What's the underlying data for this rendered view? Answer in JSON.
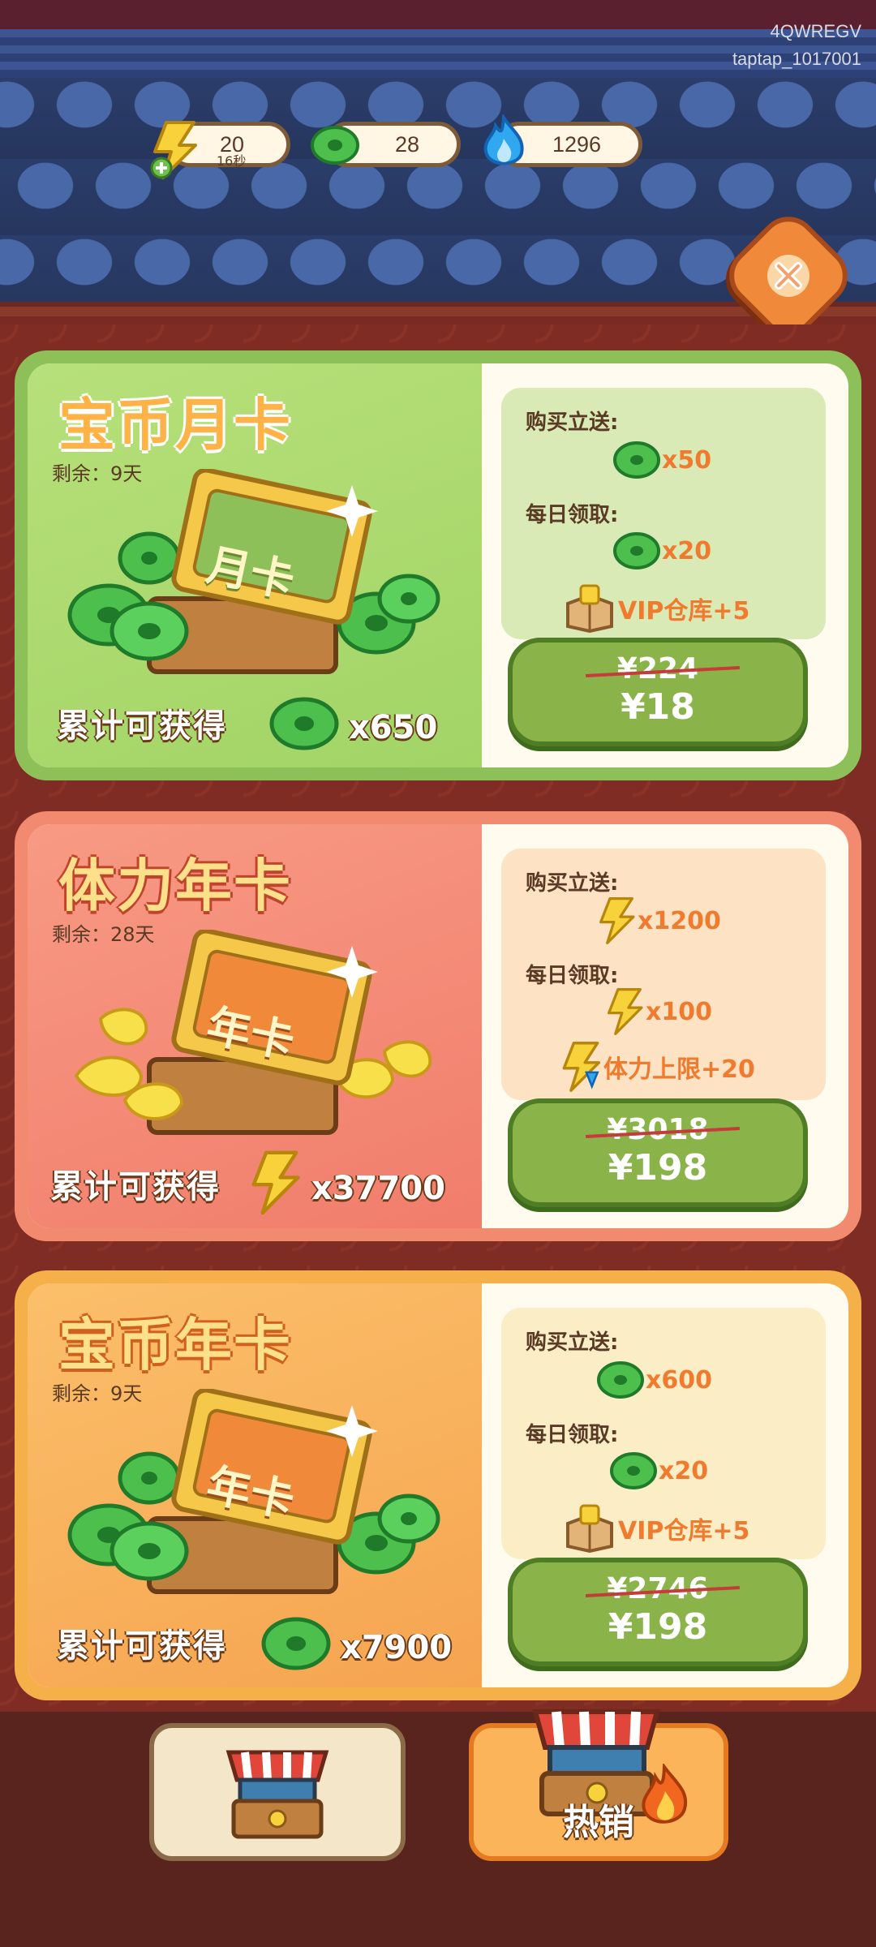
{
  "watermark": {
    "line1": "4QWREGV",
    "line2": "taptap_1017001"
  },
  "resources": {
    "stamina": {
      "value": "20",
      "timer": "16秒",
      "icon": "stamina-bolt-icon"
    },
    "coins": {
      "value": "28",
      "icon": "jade-coin-icon"
    },
    "gems": {
      "value": "1296",
      "icon": "blue-flame-icon"
    }
  },
  "cards": [
    {
      "title": "宝币月卡",
      "remain": "剩余：9天",
      "card_label": "月卡",
      "cumulative_label": "累计可获得",
      "cumulative_value": "x650",
      "buy_gift_label": "购买立送:",
      "buy_gift_value": "x50",
      "daily_label": "每日领取:",
      "daily_value": "x20",
      "bonus": "VIP仓库+5",
      "old_price": "¥224",
      "price": "¥18",
      "theme": {
        "left": "#a9d86e",
        "title": "#ffb347",
        "border": "#8ec05a",
        "box": "#d9eab6",
        "text": "#f07a2e"
      }
    },
    {
      "title": "体力年卡",
      "remain": "剩余：28天",
      "card_label": "年卡",
      "cumulative_label": "累计可获得",
      "cumulative_value": "x37700",
      "buy_gift_label": "购买立送:",
      "buy_gift_value": "x1200",
      "daily_label": "每日领取:",
      "daily_value": "x100",
      "bonus": "体力上限+20",
      "old_price": "¥3018",
      "price": "¥198",
      "theme": {
        "left": "#f48b78",
        "title": "#ffe08a",
        "border": "#f28a70",
        "box": "#fde3c4",
        "text": "#f07a2e"
      }
    },
    {
      "title": "宝币年卡",
      "remain": "剩余：9天",
      "card_label": "年卡",
      "cumulative_label": "累计可获得",
      "cumulative_value": "x7900",
      "buy_gift_label": "购买立送:",
      "buy_gift_value": "x600",
      "daily_label": "每日领取:",
      "daily_value": "x20",
      "bonus": "VIP仓库+5",
      "old_price": "¥2746",
      "price": "¥198",
      "theme": {
        "left": "#f7b060",
        "title": "#ffe08a",
        "border": "#f6b04a",
        "box": "#fbeec6",
        "text": "#f07a2e"
      }
    }
  ],
  "tabs": {
    "shop_icon": "shop-stall-icon",
    "hot_label": "热销"
  },
  "colors": {
    "roof": "#2c3f6d",
    "panel": "#7e2c24",
    "buy_button": "#8ab34a"
  }
}
